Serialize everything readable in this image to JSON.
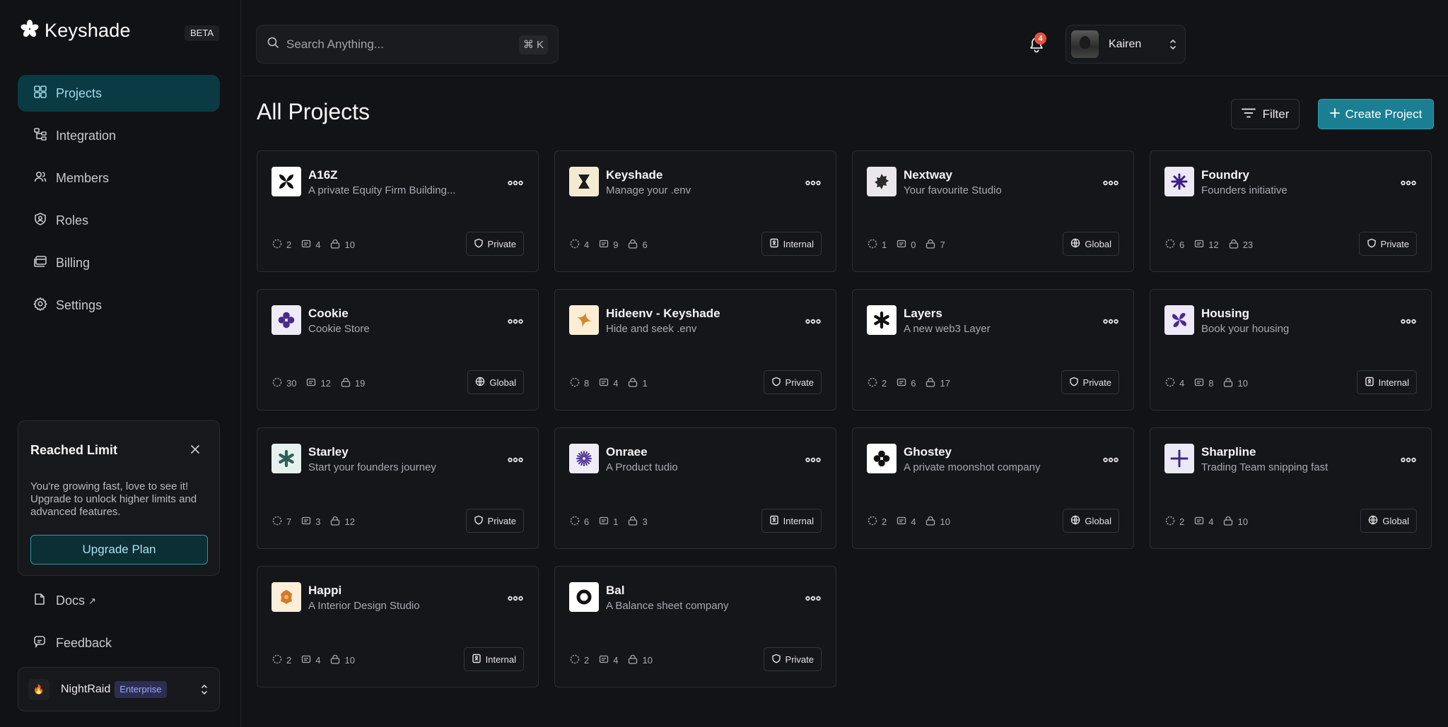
{
  "brand": {
    "name": "Keyshade",
    "beta": "BETA"
  },
  "nav": [
    {
      "label": "Projects",
      "icon": "grid-icon",
      "active": true
    },
    {
      "label": "Integration",
      "icon": "integration-icon"
    },
    {
      "label": "Members",
      "icon": "users-icon"
    },
    {
      "label": "Roles",
      "icon": "roles-icon"
    },
    {
      "label": "Billing",
      "icon": "billing-icon"
    },
    {
      "label": "Settings",
      "icon": "gear-icon"
    }
  ],
  "limit_card": {
    "title": "Reached Limit",
    "body": "You're growing fast, love to see it! Upgrade to unlock higher limits and advanced features.",
    "button": "Upgrade Plan"
  },
  "links": {
    "docs": "Docs",
    "feedback": "Feedback"
  },
  "workspace": {
    "name": "NightRaid",
    "plan": "Enterprise",
    "icon": "🔥"
  },
  "search": {
    "placeholder": "Search Anything...",
    "shortcut": "⌘ K"
  },
  "notifications": {
    "count": "4"
  },
  "user": {
    "name": "Kairen"
  },
  "main": {
    "title": "All Projects",
    "filter": "Filter",
    "create": "Create Project"
  },
  "projects": [
    {
      "name": "A16Z",
      "desc": "A private Equity Firm Building...",
      "stats": [
        "2",
        "4",
        "10"
      ],
      "visibility": "Private",
      "logo_bg": "#ffffff",
      "logo_fg": "#111111",
      "logo_icon": "x-petals"
    },
    {
      "name": "Keyshade",
      "desc": "Manage your .env",
      "stats": [
        "4",
        "9",
        "6"
      ],
      "visibility": "Internal",
      "logo_bg": "#f3ead2",
      "logo_fg": "#1c1c1c",
      "logo_icon": "hourglass"
    },
    {
      "name": "Nextway",
      "desc": "Your favourite Studio",
      "stats": [
        "1",
        "0",
        "7"
      ],
      "visibility": "Global",
      "logo_bg": "#e9e7ec",
      "logo_fg": "#2a2a2a",
      "logo_icon": "gear-star"
    },
    {
      "name": "Foundry",
      "desc": "Founders initiative",
      "stats": [
        "6",
        "12",
        "23"
      ],
      "visibility": "Private",
      "logo_bg": "#ece9f4",
      "logo_fg": "#3b1f86",
      "logo_icon": "burst"
    },
    {
      "name": "Cookie",
      "desc": "Cookie Store",
      "stats": [
        "30",
        "12",
        "19"
      ],
      "visibility": "Global",
      "logo_bg": "#eeebf5",
      "logo_fg": "#4a2a8a",
      "logo_icon": "clover"
    },
    {
      "name": "Hideenv - Keyshade",
      "desc": "Hide and seek .env",
      "stats": [
        "8",
        "4",
        "1"
      ],
      "visibility": "Private",
      "logo_bg": "#fbeed5",
      "logo_fg": "#d08a2e",
      "logo_icon": "star4"
    },
    {
      "name": "Layers",
      "desc": "A new web3 Layer",
      "stats": [
        "2",
        "6",
        "17"
      ],
      "visibility": "Private",
      "logo_bg": "#ffffff",
      "logo_fg": "#111111",
      "logo_icon": "asterisk"
    },
    {
      "name": "Housing",
      "desc": "Book your housing",
      "stats": [
        "4",
        "8",
        "10"
      ],
      "visibility": "Internal",
      "logo_bg": "#efe9f7",
      "logo_fg": "#4b2a93",
      "logo_icon": "petal-x"
    },
    {
      "name": "Starley",
      "desc": "Start your founders journey",
      "stats": [
        "7",
        "3",
        "12"
      ],
      "visibility": "Private",
      "logo_bg": "#e6f0ee",
      "logo_fg": "#2f5f5a",
      "logo_icon": "asterisk"
    },
    {
      "name": "Onraee",
      "desc": "A Product tudio",
      "stats": [
        "6",
        "1",
        "3"
      ],
      "visibility": "Internal",
      "logo_bg": "#efecf6",
      "logo_fg": "#4b2f93",
      "logo_icon": "sunburst"
    },
    {
      "name": "Ghostey",
      "desc": "A private moonshot company",
      "stats": [
        "2",
        "4",
        "10"
      ],
      "visibility": "Global",
      "logo_bg": "#ffffff",
      "logo_fg": "#111111",
      "logo_icon": "clover"
    },
    {
      "name": "Sharpline",
      "desc": "Trading Team snipping fast",
      "stats": [
        "2",
        "4",
        "10"
      ],
      "visibility": "Global",
      "logo_bg": "#ece9f6",
      "logo_fg": "#3b2a86",
      "logo_icon": "plus"
    },
    {
      "name": "Happi",
      "desc": "A Interior Design Studio",
      "stats": [
        "2",
        "4",
        "10"
      ],
      "visibility": "Internal",
      "logo_bg": "#fbefd9",
      "logo_fg": "#d27b2a",
      "logo_icon": "flower"
    },
    {
      "name": "Bal",
      "desc": "A Balance sheet company",
      "stats": [
        "2",
        "4",
        "10"
      ],
      "visibility": "Private",
      "logo_bg": "#ffffff",
      "logo_fg": "#111111",
      "logo_icon": "ring"
    }
  ]
}
